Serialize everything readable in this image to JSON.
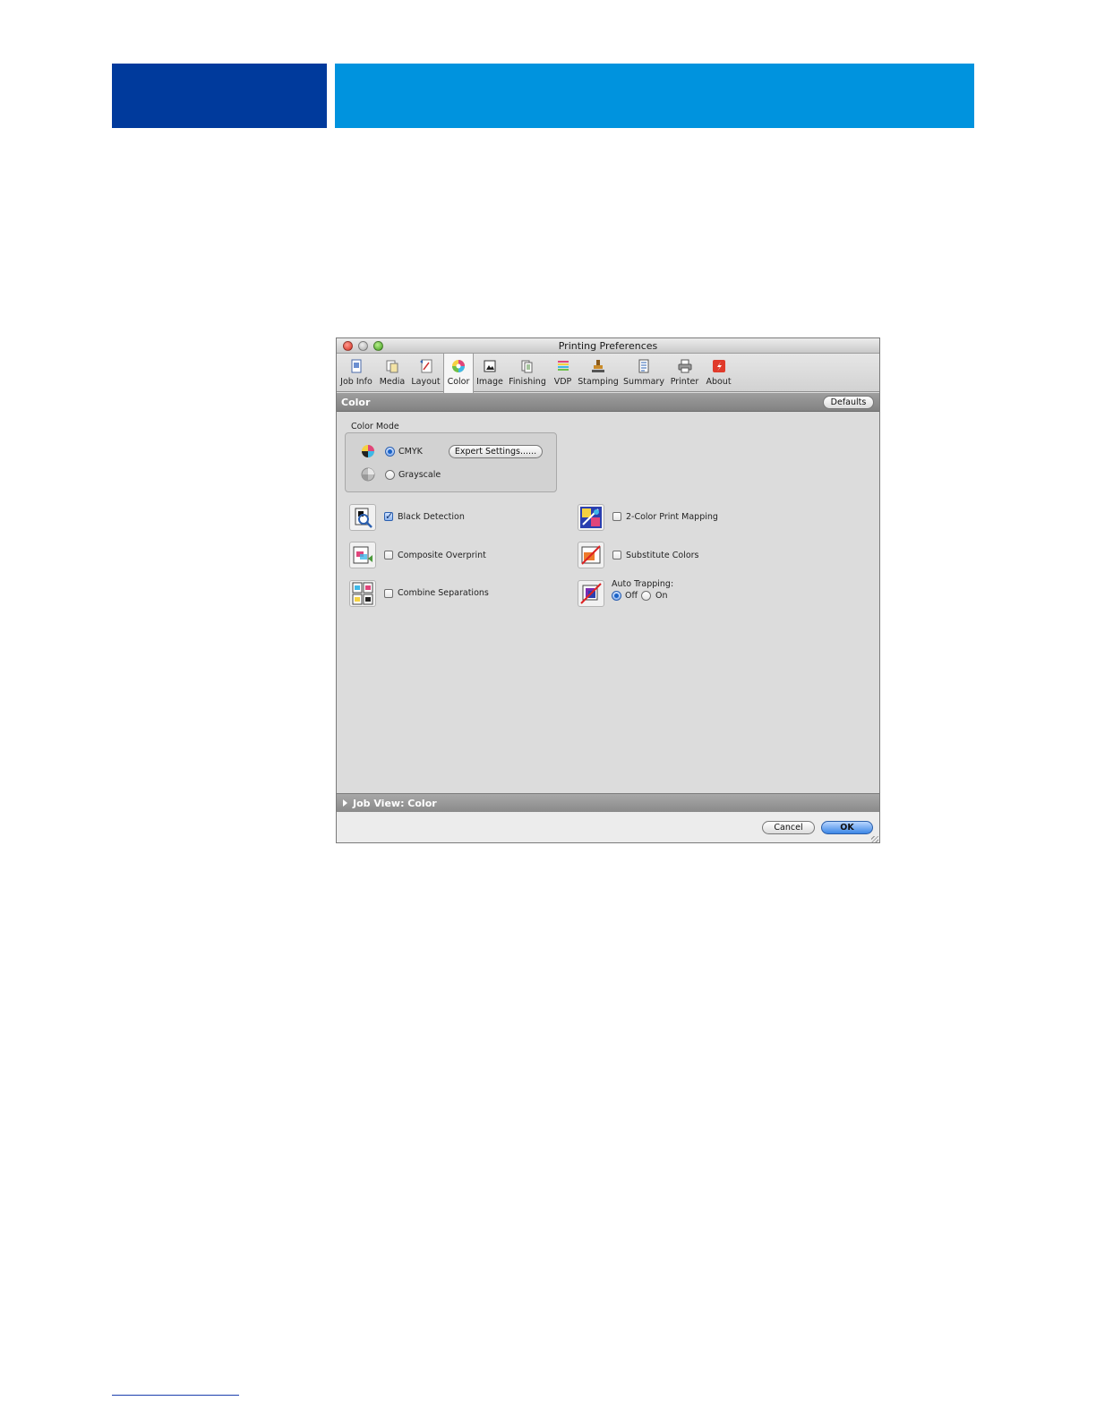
{
  "window": {
    "title": "Printing Preferences"
  },
  "toolbar": {
    "tabs": [
      {
        "label": "Job Info",
        "icon": "job-info-icon"
      },
      {
        "label": "Media",
        "icon": "media-icon"
      },
      {
        "label": "Layout",
        "icon": "layout-icon"
      },
      {
        "label": "Color",
        "icon": "color-icon",
        "selected": true
      },
      {
        "label": "Image",
        "icon": "image-icon"
      },
      {
        "label": "Finishing",
        "icon": "finishing-icon"
      },
      {
        "label": "VDP",
        "icon": "vdp-icon"
      },
      {
        "label": "Stamping",
        "icon": "stamping-icon"
      },
      {
        "label": "Summary",
        "icon": "summary-icon"
      },
      {
        "label": "Printer",
        "icon": "printer-icon"
      },
      {
        "label": "About",
        "icon": "about-icon"
      }
    ]
  },
  "section": {
    "title": "Color",
    "defaults_label": "Defaults"
  },
  "color_mode": {
    "label": "Color Mode",
    "cmyk_label": "CMYK",
    "cmyk_selected": true,
    "grayscale_label": "Grayscale",
    "grayscale_selected": false,
    "expert_settings_label": "Expert Settings......"
  },
  "options": {
    "black_detection": {
      "label": "Black Detection",
      "checked": true
    },
    "composite_overprint": {
      "label": "Composite Overprint",
      "checked": false
    },
    "combine_separations": {
      "label": "Combine Separations",
      "checked": false
    },
    "two_color_print_mapping": {
      "label": "2-Color Print Mapping",
      "checked": false
    },
    "substitute_colors": {
      "label": "Substitute Colors",
      "checked": false
    },
    "auto_trapping": {
      "label": "Auto Trapping:",
      "off_label": "Off",
      "on_label": "On",
      "value": "Off"
    }
  },
  "job_view": {
    "label": "Job View: Color"
  },
  "buttons": {
    "cancel": "Cancel",
    "ok": "OK"
  },
  "colors": {
    "banner_dark": "#003a9c",
    "banner_light": "#0093de",
    "accent": "#3b86e6"
  }
}
